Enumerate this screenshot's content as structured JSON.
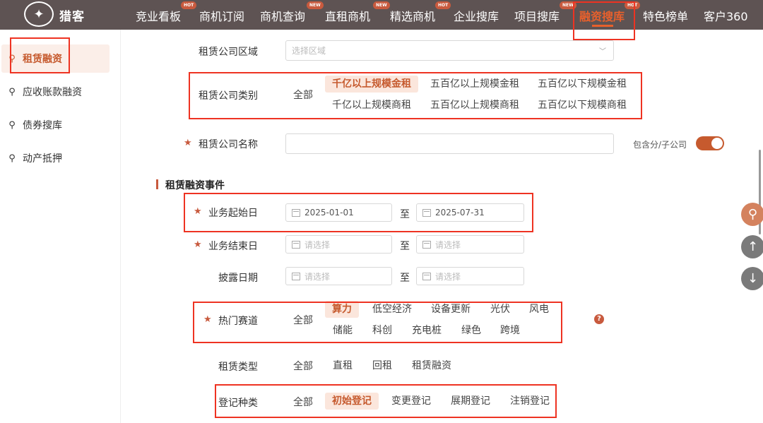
{
  "header": {
    "logo_text": "猎客",
    "nav": [
      {
        "label": "竞业看板",
        "badge": "HOT"
      },
      {
        "label": "商机订阅",
        "badge": ""
      },
      {
        "label": "商机查询",
        "badge": "NEW"
      },
      {
        "label": "直租商机",
        "badge": "NEW"
      },
      {
        "label": "精选商机",
        "badge": "HOT"
      },
      {
        "label": "企业搜库",
        "badge": ""
      },
      {
        "label": "项目搜库",
        "badge": "NEW"
      },
      {
        "label": "融资搜库",
        "badge": "HOT"
      },
      {
        "label": "特色榜单",
        "badge": ""
      },
      {
        "label": "客户360",
        "badge": ""
      }
    ]
  },
  "sidebar": {
    "items": [
      {
        "label": "租赁融资",
        "icon": "search-icon"
      },
      {
        "label": "应收账款融资",
        "icon": "search-icon"
      },
      {
        "label": "债券搜库",
        "icon": "search-icon"
      },
      {
        "label": "动产抵押",
        "icon": "search-icon"
      }
    ]
  },
  "form": {
    "region": {
      "label": "租赁公司区域",
      "placeholder": "选择区域"
    },
    "category": {
      "label": "租赁公司类别",
      "all": "全部",
      "options": [
        "千亿以上规模金租",
        "五百亿以上规模金租",
        "五百亿以下规模金租",
        "千亿以上规模商租",
        "五百亿以上规模商租",
        "五百亿以下规模商租"
      ]
    },
    "company_name": {
      "label": "租赁公司名称",
      "value": "",
      "toggle_label": "包含分/子公司"
    },
    "section_title": "租赁融资事件",
    "start_date": {
      "label": "业务起始日",
      "from": "2025-01-01",
      "sep": "至",
      "to": "2025-07-31"
    },
    "end_date": {
      "label": "业务结束日",
      "from": "请选择",
      "sep": "至",
      "to": "请选择"
    },
    "disclosure_date": {
      "label": "披露日期",
      "from": "请选择",
      "sep": "至",
      "to": "请选择"
    },
    "hot_track": {
      "label": "热门赛道",
      "all": "全部",
      "options": [
        "算力",
        "低空经济",
        "设备更新",
        "光伏",
        "风电",
        "储能",
        "科创",
        "充电桩",
        "绿色",
        "跨境"
      ],
      "help": "?"
    },
    "lease_type": {
      "label": "租赁类型",
      "all": "全部",
      "options": [
        "直租",
        "回租",
        "租赁融资"
      ]
    },
    "register_type": {
      "label": "登记种类",
      "all": "全部",
      "options": [
        "初始登记",
        "变更登记",
        "展期登记",
        "注销登记"
      ]
    }
  },
  "colors": {
    "accent": "#c65a2e",
    "header_bg": "#5e5353",
    "highlight": "#e32222"
  }
}
